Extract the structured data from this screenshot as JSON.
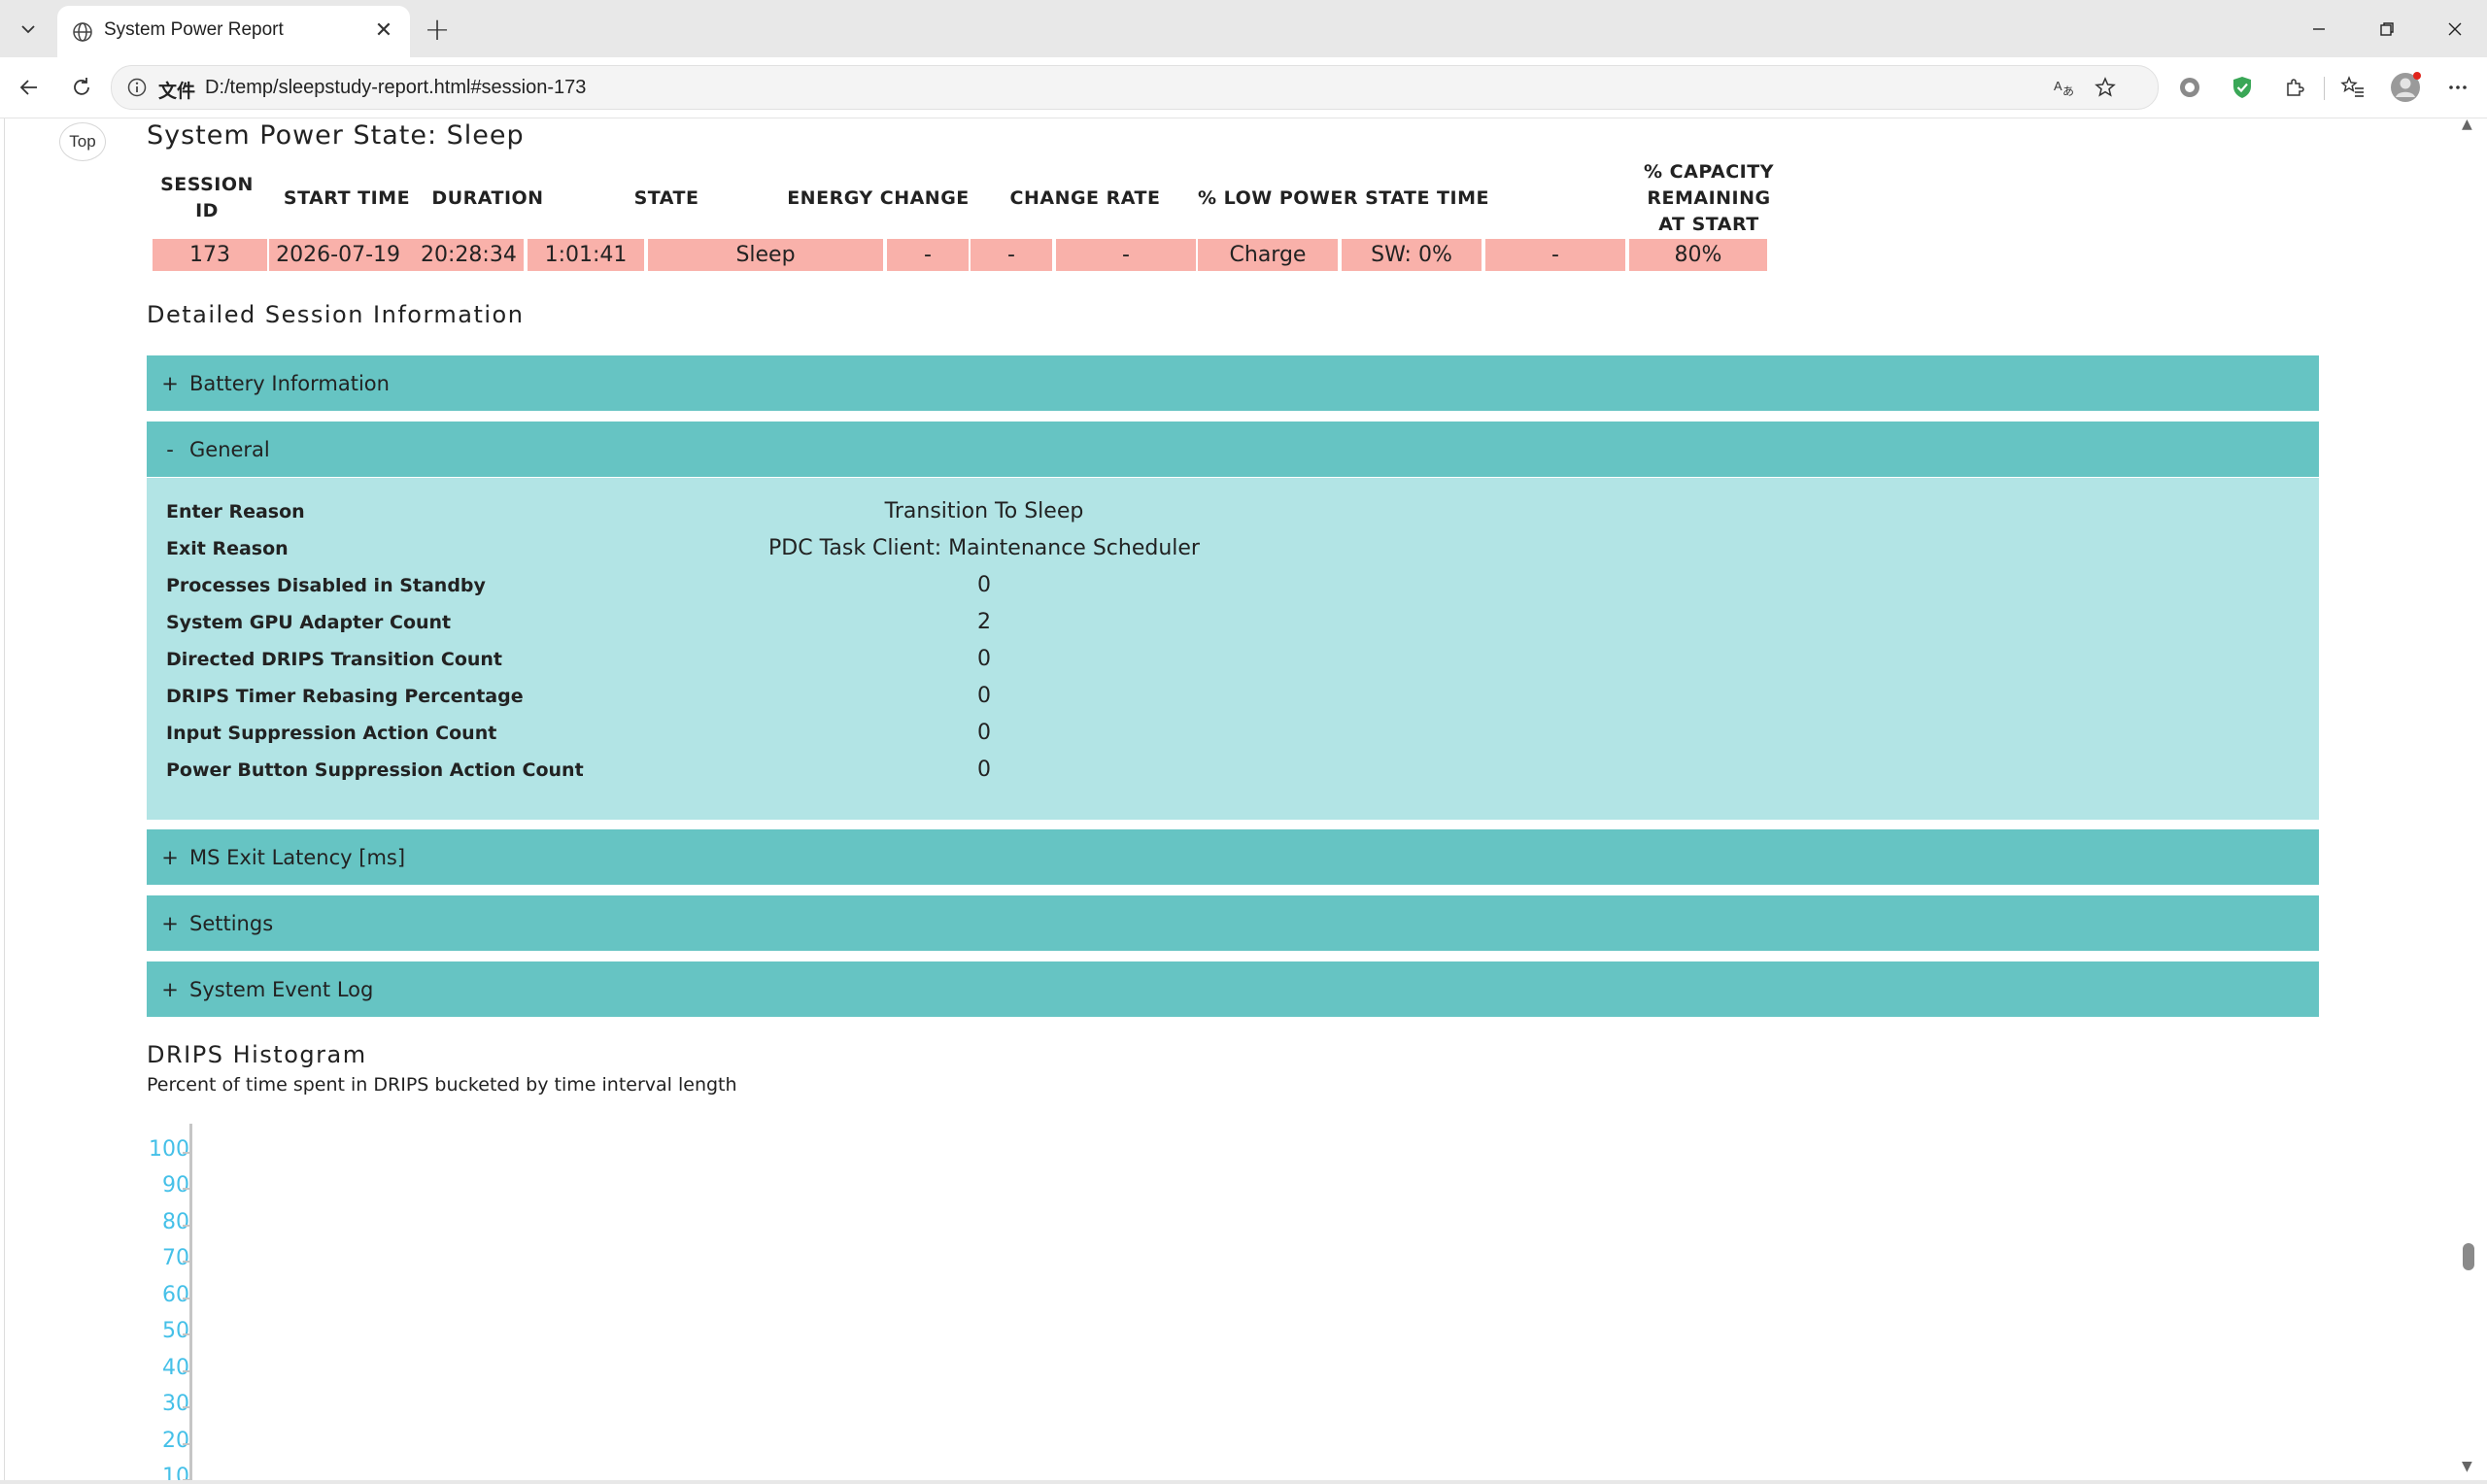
{
  "browser": {
    "tab_title": "System Power Report",
    "url_prefix": "文件",
    "url": "D:/temp/sleepstudy-report.html#session-173"
  },
  "page": {
    "top_button": "Top",
    "section_title": "System Power State: Sleep",
    "summary_table": {
      "headers": [
        "SESSION ID",
        "START TIME",
        "DURATION",
        "STATE",
        "ENERGY CHANGE",
        "CHANGE RATE",
        "% LOW POWER STATE TIME",
        "% CAPACITY REMAINING AT START"
      ],
      "row": [
        "173",
        "2026-07-19   20:28:34",
        "1:01:41",
        "Sleep",
        "-",
        "-",
        "-",
        "Charge",
        "SW: 0%",
        "-",
        "80%"
      ]
    },
    "details_title": "Detailed Session Information",
    "accordions": [
      {
        "toggle": "+",
        "label": "Battery Information"
      },
      {
        "toggle": "-",
        "label": "General"
      },
      {
        "toggle": "+",
        "label": "MS Exit Latency [ms]"
      },
      {
        "toggle": "+",
        "label": "Settings"
      },
      {
        "toggle": "+",
        "label": "System Event Log"
      }
    ],
    "general": [
      {
        "key": "Enter Reason",
        "value": "Transition To Sleep"
      },
      {
        "key": "Exit Reason",
        "value": "PDC Task Client: Maintenance Scheduler"
      },
      {
        "key": "Processes Disabled in Standby",
        "value": "0"
      },
      {
        "key": "System GPU Adapter Count",
        "value": "2"
      },
      {
        "key": "Directed DRIPS Transition Count",
        "value": "0"
      },
      {
        "key": "DRIPS Timer Rebasing Percentage",
        "value": "0"
      },
      {
        "key": "Input Suppression Action Count",
        "value": "0"
      },
      {
        "key": "Power Button Suppression Action Count",
        "value": "0"
      }
    ],
    "histogram": {
      "title": "DRIPS Histogram",
      "subtitle": "Percent of time spent in DRIPS bucketed by time interval length",
      "y_labels": [
        "100",
        "90",
        "80",
        "70",
        "60",
        "50",
        "40",
        "30",
        "20",
        "10"
      ],
      "label_color": "#45c0e8"
    }
  },
  "colors": {
    "accordion_header": "#66c4c3",
    "accordion_body": "#b2e4e5",
    "summary_row": "#f9b1aa"
  }
}
